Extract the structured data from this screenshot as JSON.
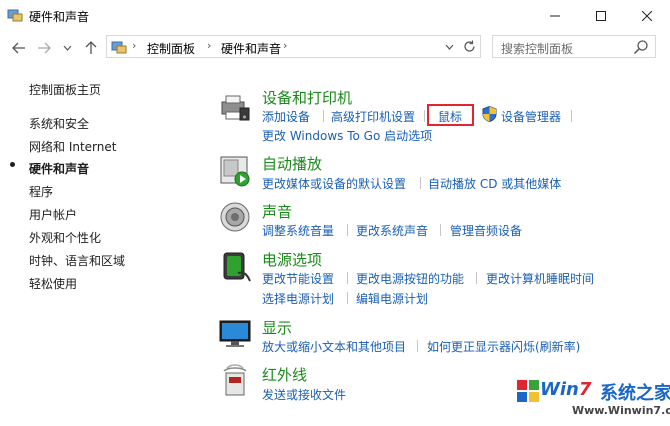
{
  "window": {
    "title": "硬件和声音",
    "icons": {
      "app": "control-panel-icon",
      "minimize": "minimize-icon",
      "maximize": "maximize-icon",
      "close": "close-icon"
    }
  },
  "nav": {
    "back_icon": "back-arrow-icon",
    "forward_icon": "forward-arrow-icon",
    "recent_icon": "chevron-down-icon",
    "up_icon": "up-arrow-icon"
  },
  "address": {
    "crumbs": [
      "控制面板",
      "硬件和声音"
    ],
    "separator": "›",
    "refresh_icon": "refresh-icon"
  },
  "search": {
    "placeholder": "搜索控制面板",
    "icon": "search-icon"
  },
  "sidebar": {
    "items": [
      {
        "label": "控制面板主页"
      },
      {
        "label": "系统和安全"
      },
      {
        "label": "网络和 Internet"
      },
      {
        "label": "硬件和声音",
        "current": true
      },
      {
        "label": "程序"
      },
      {
        "label": "用户帐户"
      },
      {
        "label": "外观和个性化"
      },
      {
        "label": "时钟、语言和区域"
      },
      {
        "label": "轻松使用"
      }
    ]
  },
  "categories": [
    {
      "title": "设备和打印机",
      "icon": "printer-icon",
      "rows": [
        [
          "添加设备",
          "高级打印机设置",
          "鼠标",
          "设备管理器"
        ],
        [
          "更改 Windows To Go 启动选项"
        ]
      ]
    },
    {
      "title": "自动播放",
      "icon": "autoplay-icon",
      "rows": [
        [
          "更改媒体或设备的默认设置",
          "自动播放 CD 或其他媒体"
        ]
      ]
    },
    {
      "title": "声音",
      "icon": "speaker-icon",
      "rows": [
        [
          "调整系统音量",
          "更改系统声音",
          "管理音频设备"
        ]
      ]
    },
    {
      "title": "电源选项",
      "icon": "battery-icon",
      "rows": [
        [
          "更改节能设置",
          "更改电源按钮的功能",
          "更改计算机睡眠时间"
        ],
        [
          "选择电源计划",
          "编辑电源计划"
        ]
      ]
    },
    {
      "title": "显示",
      "icon": "monitor-icon",
      "rows": [
        [
          "放大或缩小文本和其他项目",
          "如何更正显示器闪烁(刷新率)"
        ]
      ]
    },
    {
      "title": "红外线",
      "icon": "infrared-icon",
      "rows": [
        [
          "发送或接收文件"
        ]
      ]
    }
  ],
  "highlight_color": "#e0262f",
  "watermark": {
    "logo_prefix": "Win",
    "logo_seven": "7",
    "logo_cn": "系统之家",
    "url": "Www.Winwin7.com"
  }
}
